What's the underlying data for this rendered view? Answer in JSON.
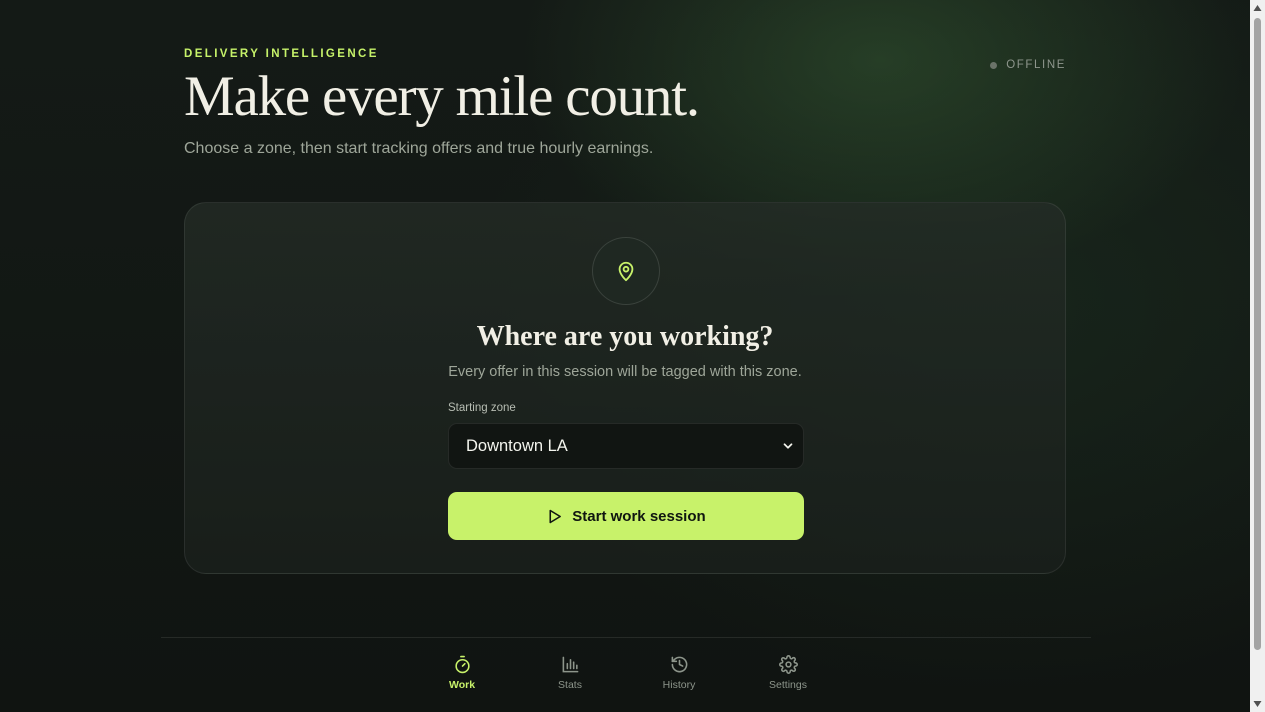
{
  "header": {
    "eyebrow": "DELIVERY INTELLIGENCE",
    "title": "Make every mile count.",
    "subtitle": "Choose a zone, then start tracking offers and true hourly earnings.",
    "status": "OFFLINE"
  },
  "card": {
    "icon": "map-pin-icon",
    "title": "Where are you working?",
    "subtitle": "Every offer in this session will be tagged with this zone.",
    "zone_label": "Starting zone",
    "zone_value": "Downtown LA",
    "start_button": "Start work session"
  },
  "nav": {
    "items": [
      {
        "label": "Work",
        "icon": "stopwatch-icon",
        "active": true
      },
      {
        "label": "Stats",
        "icon": "bar-chart-icon",
        "active": false
      },
      {
        "label": "History",
        "icon": "history-icon",
        "active": false
      },
      {
        "label": "Settings",
        "icon": "gear-icon",
        "active": false
      }
    ]
  },
  "colors": {
    "accent": "#c8f26a",
    "background": "#131814",
    "card": "#1f2622",
    "offline_dot": "#6b7369"
  }
}
